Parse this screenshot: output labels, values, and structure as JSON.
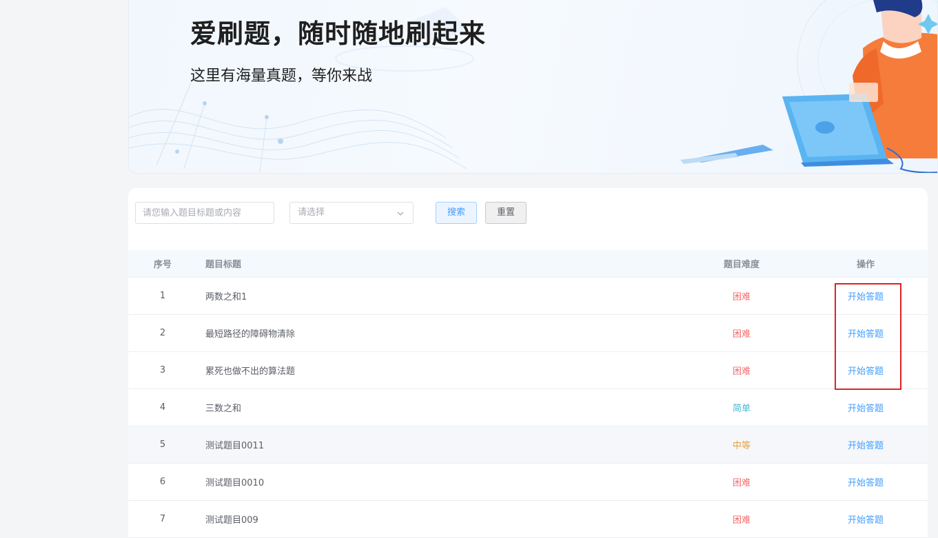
{
  "banner": {
    "title": "爱刷题，随时随地刷起来",
    "subtitle": "这里有海量真题，等你来战"
  },
  "filters": {
    "search_placeholder": "请您输入题目标题或内容",
    "select_placeholder": "请选择",
    "search_label": "搜索",
    "reset_label": "重置"
  },
  "table": {
    "headers": {
      "index": "序号",
      "title": "题目标题",
      "difficulty": "题目难度",
      "action": "操作"
    },
    "rows": [
      {
        "index": "1",
        "title": "两数之和1",
        "difficulty": "困难",
        "action": "开始答题"
      },
      {
        "index": "2",
        "title": "最短路径的障碍物清除",
        "difficulty": "困难",
        "action": "开始答题"
      },
      {
        "index": "3",
        "title": "累死也做不出的算法题",
        "difficulty": "困难",
        "action": "开始答题"
      },
      {
        "index": "4",
        "title": "三数之和",
        "difficulty": "简单",
        "action": "开始答题"
      },
      {
        "index": "5",
        "title": "测试题目0011",
        "difficulty": "中等",
        "action": "开始答题"
      },
      {
        "index": "6",
        "title": "测试题目0010",
        "difficulty": "困难",
        "action": "开始答题"
      },
      {
        "index": "7",
        "title": "测试题目009",
        "difficulty": "困难",
        "action": "开始答题"
      }
    ]
  },
  "colors": {
    "hard": "#f56c6c",
    "easy": "#49b6d2",
    "medium": "#e6a23c",
    "link": "#409eff",
    "highlight_box": "#e02020"
  }
}
